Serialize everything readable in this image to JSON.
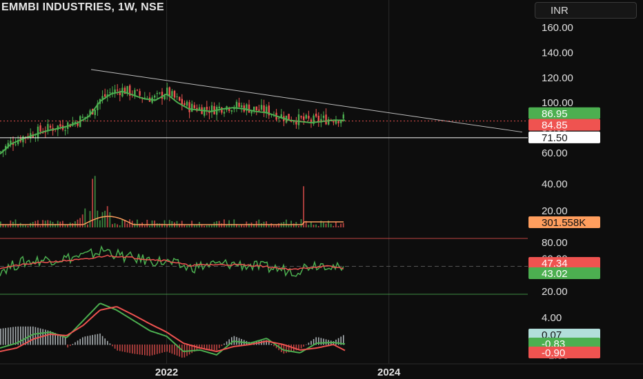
{
  "header": {
    "title": "EMMBI INDUSTRIES, 1W, NSE",
    "currency": "INR"
  },
  "colors": {
    "background": "#0d0d0d",
    "up": "#4caf50",
    "down": "#ef5350",
    "ma": "#4caf50",
    "volume_ma": "#ff9e5e",
    "rsi": "#4caf50",
    "rsi_signal": "#ef5350",
    "macd": "#4caf50",
    "macd_signal": "#ef5350",
    "trendline": "#bfbfbf",
    "text": "#e0e0e0"
  },
  "chart_data": [
    {
      "type": "line",
      "panel": "price",
      "y_scale": "linear",
      "ylim": [
        45,
        165
      ],
      "y_ticks": [
        "160.00",
        "140.00",
        "120.00",
        "100.00",
        "80.00",
        "60.00"
      ],
      "x_ticks": [
        "2022",
        "2024"
      ],
      "x_tick_years": [
        2022,
        2024
      ],
      "xlim_years": [
        2020.5,
        2025.25
      ],
      "last_data_year": 2023.61,
      "series": [
        {
          "x_years": [
            2020.5,
            2020.6,
            2020.7,
            2020.8,
            2020.9,
            2021.0,
            2021.1,
            2021.2,
            2021.3,
            2021.4,
            2021.5,
            2021.6,
            2021.7,
            2021.8,
            2021.9,
            2022.0,
            2022.1,
            2022.2,
            2022.3,
            2022.4,
            2022.5,
            2022.6,
            2022.7,
            2022.8,
            2022.9,
            2023.0,
            2023.1,
            2023.2,
            2023.3,
            2023.4,
            2023.5,
            2023.61
          ],
          "values": [
            60,
            68,
            72,
            75,
            78,
            80,
            82,
            85,
            90,
            102,
            108,
            110,
            107,
            104,
            103,
            108,
            101,
            96,
            95,
            94,
            96,
            97,
            96,
            94,
            93,
            90,
            87,
            86,
            85,
            86,
            87,
            86.95
          ]
        }
      ],
      "current_price": 84.85,
      "ma_value": 86.95,
      "horizontal_level": 71.5,
      "trendline": {
        "from": {
          "year": 2021.32,
          "value": 126
        },
        "to": {
          "year": 2025.2,
          "value": 76
        }
      },
      "price_labels": [
        "86.95",
        "84.85",
        "71.50"
      ]
    },
    {
      "type": "bar",
      "panel": "volume",
      "current_value_label": "301.558K",
      "spikes_years": [
        2021.33,
        2021.36,
        2023.23
      ],
      "spike_values": [
        0.85,
        0.9,
        0.72
      ]
    },
    {
      "type": "line",
      "panel": "rsi",
      "ylim": [
        15,
        85
      ],
      "y_ticks": [
        "80.00",
        "60.00",
        "20.00"
      ],
      "levels": [
        80,
        50,
        20
      ],
      "series": [
        {
          "x_years": [
            2020.5,
            2020.7,
            2020.9,
            2021.1,
            2021.3,
            2021.45,
            2021.6,
            2021.8,
            2022.0,
            2022.2,
            2022.4,
            2022.6,
            2022.8,
            2023.0,
            2023.15,
            2023.3,
            2023.45,
            2023.61
          ],
          "values": [
            45,
            55,
            58,
            60,
            64,
            70,
            62,
            58,
            55,
            48,
            52,
            53,
            50,
            47,
            44,
            52,
            53,
            43.02
          ]
        },
        {
          "x_years": [
            2020.5,
            2020.7,
            2020.9,
            2021.1,
            2021.3,
            2021.45,
            2021.6,
            2021.8,
            2022.0,
            2022.2,
            2022.4,
            2022.6,
            2022.8,
            2023.0,
            2023.15,
            2023.3,
            2023.45,
            2023.61
          ],
          "values": [
            48,
            52,
            55,
            57,
            59,
            63,
            62,
            59,
            57,
            51,
            52,
            52,
            51,
            48,
            46,
            49,
            50,
            47.34
          ]
        }
      ],
      "value_labels": [
        "47.34",
        "43.02"
      ]
    },
    {
      "type": "line",
      "panel": "macd",
      "ylim": [
        -2,
        6.5
      ],
      "y_ticks": [
        "4.00"
      ],
      "series": [
        {
          "x_years": [
            2020.5,
            2020.65,
            2020.8,
            2020.95,
            2021.1,
            2021.25,
            2021.4,
            2021.55,
            2021.7,
            2021.85,
            2022.0,
            2022.15,
            2022.3,
            2022.45,
            2022.6,
            2022.75,
            2022.9,
            2023.05,
            2023.2,
            2023.35,
            2023.5,
            2023.61
          ],
          "values": [
            -0.5,
            0.2,
            1.5,
            1.8,
            1.0,
            3.5,
            6.0,
            5.0,
            3.5,
            2.0,
            1.2,
            -1.0,
            -0.8,
            -1.5,
            0.5,
            0.2,
            0.9,
            -0.8,
            -1.2,
            0.2,
            0.3,
            0.07
          ]
        },
        {
          "x_years": [
            2020.5,
            2020.65,
            2020.8,
            2020.95,
            2021.1,
            2021.25,
            2021.4,
            2021.55,
            2021.7,
            2021.85,
            2022.0,
            2022.15,
            2022.3,
            2022.45,
            2022.6,
            2022.75,
            2022.9,
            2023.05,
            2023.2,
            2023.35,
            2023.5,
            2023.61
          ],
          "values": [
            -1.0,
            -0.5,
            0.8,
            1.5,
            1.3,
            2.8,
            5.0,
            5.5,
            4.3,
            3.0,
            1.8,
            0.2,
            -0.5,
            -1.0,
            -0.3,
            0.0,
            0.5,
            0.0,
            -0.8,
            -0.5,
            0.0,
            -0.9
          ]
        }
      ],
      "value_labels": [
        "0.07",
        "-0.83",
        "-0.90"
      ]
    }
  ]
}
